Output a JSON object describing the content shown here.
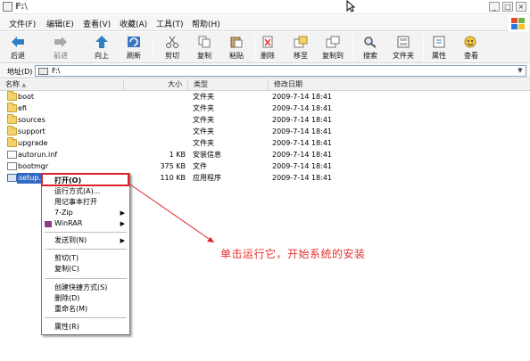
{
  "window": {
    "title": "F:\\"
  },
  "menu": [
    "文件(F)",
    "编辑(E)",
    "查看(V)",
    "收藏(A)",
    "工具(T)",
    "帮助(H)"
  ],
  "toolbar": {
    "back": "后退",
    "forward": "前进",
    "up": "向上",
    "refresh": "刷新",
    "cut": "剪切",
    "copy": "复制",
    "paste": "粘贴",
    "delete": "删除",
    "move_to": "移至",
    "copy_to": "复制到",
    "search": "搜索",
    "folders": "文件夹",
    "properties": "属性",
    "view": "查看"
  },
  "address": {
    "label": "地址(D)",
    "value": "F:\\"
  },
  "columns": {
    "name": "名称",
    "size": "大小",
    "type": "类型",
    "modified": "修改日期"
  },
  "files": [
    {
      "name": "boot",
      "size": "",
      "type": "文件夹",
      "modified": "2009-7-14 18:41",
      "kind": "folder"
    },
    {
      "name": "efi",
      "size": "",
      "type": "文件夹",
      "modified": "2009-7-14 18:41",
      "kind": "folder"
    },
    {
      "name": "sources",
      "size": "",
      "type": "文件夹",
      "modified": "2009-7-14 18:41",
      "kind": "folder"
    },
    {
      "name": "support",
      "size": "",
      "type": "文件夹",
      "modified": "2009-7-14 18:41",
      "kind": "folder"
    },
    {
      "name": "upgrade",
      "size": "",
      "type": "文件夹",
      "modified": "2009-7-14 18:41",
      "kind": "folder"
    },
    {
      "name": "autorun.inf",
      "size": "1 KB",
      "type": "安装信息",
      "modified": "2009-7-14 18:41",
      "kind": "file"
    },
    {
      "name": "bootmgr",
      "size": "375 KB",
      "type": "文件",
      "modified": "2009-7-14 18:41",
      "kind": "file"
    },
    {
      "name": "setup.e",
      "size": "110 KB",
      "type": "应用程序",
      "modified": "2009-7-14 18:41",
      "kind": "setup"
    }
  ],
  "context_menu": [
    {
      "label": "打开(O)",
      "default": true
    },
    {
      "label": "运行方式(A)..."
    },
    {
      "label": "用记事本打开"
    },
    {
      "label": "7-Zip",
      "submenu": true
    },
    {
      "label": "WinRAR",
      "submenu": true
    },
    {
      "label": "发送到(N)",
      "submenu": true
    },
    {
      "label": "剪切(T)"
    },
    {
      "label": "复制(C)"
    },
    {
      "label": "创建快捷方式(S)"
    },
    {
      "label": "删除(D)"
    },
    {
      "label": "重命名(M)"
    },
    {
      "label": "属性(R)"
    }
  ],
  "annotation": "单击运行它，开始系统的安装",
  "colors": {
    "annotation": "#e6312e",
    "highlight": "#d8232a",
    "selection": "#316ac5"
  }
}
